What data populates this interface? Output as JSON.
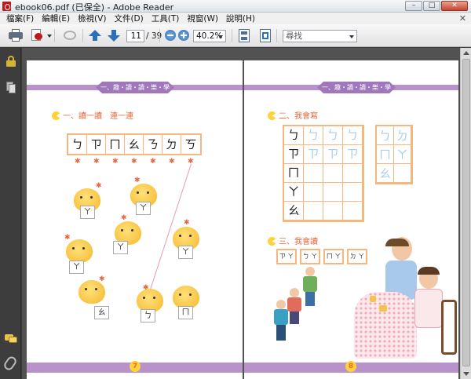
{
  "titlebar": {
    "title": "ebook06.pdf (已保全) - Adobe Reader",
    "minimize": "–",
    "maximize": "□",
    "close": "✕"
  },
  "menu": [
    "檔案(F)",
    "編輯(E)",
    "檢視(V)",
    "文件(D)",
    "工具(T)",
    "視窗(W)",
    "說明(H)"
  ],
  "menu_close": "✕",
  "toolbar": {
    "page_current": "11",
    "page_total": "/ 39",
    "zoom": "40.2%",
    "search_placeholder": "尋找"
  },
  "left_page": {
    "header": "一、趣・讀・讀・樂・學",
    "section_title": "一、讀一讀　連一連",
    "symbols": [
      "ㄅ",
      "ㄗ",
      "ㄇ",
      "ㄠ",
      "ㄋ",
      "ㄉ",
      "ㄎ"
    ],
    "chick_cards": [
      "ㄚ",
      "ㄚ",
      "ㄚ",
      "ㄚ",
      "ㄚ",
      "ㄚ",
      "ㄠ",
      "ㄅ",
      "ㄇ"
    ],
    "page_number": "7"
  },
  "right_page": {
    "header": "一、趣・讀・讀・樂・學",
    "section2_title": "二、我會寫",
    "section3_title": "三、我會讀",
    "write_rows": [
      "ㄅ",
      "ㄗ",
      "ㄇ",
      "ㄚ",
      "ㄠ"
    ],
    "trace_glyph": "ㄅ",
    "small_grid": [
      "ㄅ",
      "ㄉ",
      "ㄇ",
      "ㄚ",
      "ㄠ",
      ""
    ],
    "read_words": [
      "ㄗ ㄚ",
      "ㄅ ㄚ",
      "ㄇ ㄚ",
      "ㄉ ㄚ"
    ],
    "page_number": "8"
  },
  "colors": {
    "accent_purple": "#9f77ba",
    "band_purple": "#b793c9",
    "grid_orange": "#f4b77e",
    "title_orange": "#e8663b"
  },
  "icons": [
    "printer-icon",
    "create-pdf-icon",
    "share-icon",
    "page-up-icon",
    "page-down-icon",
    "zoom-out-icon",
    "zoom-in-icon",
    "fit-page-icon",
    "full-screen-icon",
    "lock-icon",
    "pages-icon",
    "comment-icon",
    "attachment-icon"
  ]
}
